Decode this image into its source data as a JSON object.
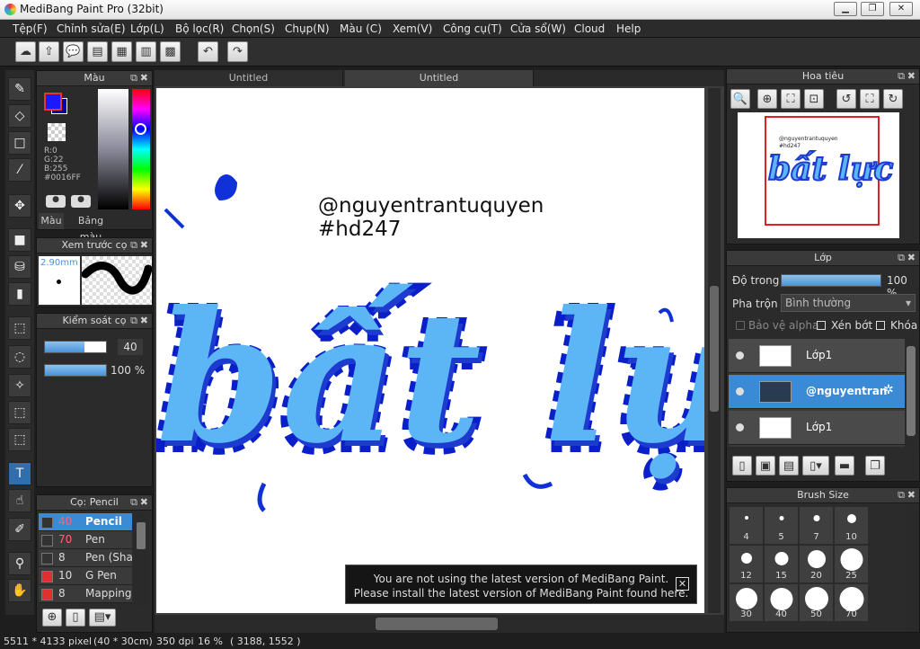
{
  "window": {
    "title": "MediBang Paint Pro (32bit)"
  },
  "menu": [
    "Tệp(F)",
    "Chỉnh sửa(E)",
    "Lớp(L)",
    "Bộ lọc(R)",
    "Chọn(S)",
    "Chụp(N)",
    "Màu (C)",
    "Xem(V)",
    "Công cụ(T)",
    "Cửa sổ(W)",
    "Cloud",
    "Help"
  ],
  "tabs": [
    "Untitled",
    "Untitled"
  ],
  "color_panel": {
    "title": "Màu",
    "r": "R:0",
    "g": "G:22",
    "b": "B:255",
    "hex": "#0016FF",
    "tab1": "Màu",
    "tab2": "Bảng màu",
    "primary": "#1a1aff",
    "secondary": "#0000aa"
  },
  "brush_preview": {
    "title": "Xem trước cọ",
    "size": "2.90mm"
  },
  "brush_control": {
    "title": "Kiểm soát cọ",
    "size_value": "40",
    "opacity_value": "100 %"
  },
  "brush_list": {
    "title": "Cọ: Pencil",
    "items": [
      {
        "num": "40",
        "name": "Pencil",
        "color": "#333333",
        "active": true
      },
      {
        "num": "70",
        "name": "Pen",
        "color": "#333333",
        "active": false
      },
      {
        "num": "8",
        "name": "Pen (Sha",
        "color": "#333333",
        "active": false
      },
      {
        "num": "10",
        "name": "G Pen",
        "color": "#e03030",
        "active": false
      },
      {
        "num": "8",
        "name": "Mapping",
        "color": "#e03030",
        "active": false
      }
    ]
  },
  "navigator": {
    "title": "Hoa tiêu",
    "thumb_handle": "@nguyentrantuquyen",
    "thumb_tag": "#hd247"
  },
  "layers": {
    "title": "Lớp",
    "opacity_label": "Độ trong",
    "opacity_value": "100 %",
    "opacity": 1.0,
    "blend_label": "Pha trộn",
    "blend_value": "Bình thường",
    "alpha_label": "Bảo vệ alpha",
    "clip_label": "Xén bớt",
    "lock_label": "Khóa",
    "items": [
      {
        "name": "Lớp1",
        "selected": false
      },
      {
        "name": "@nguyentran",
        "selected": true
      },
      {
        "name": "Lớp1",
        "selected": false
      }
    ]
  },
  "brush_size": {
    "title": "Brush Size",
    "sizes": [
      "4",
      "5",
      "7",
      "10",
      "12",
      "15",
      "20",
      "25",
      "30",
      "40",
      "50",
      "70"
    ]
  },
  "canvas": {
    "handle": "@nguyentrantuquyen",
    "tag": "#hd247",
    "art_text": "bất lực"
  },
  "notice": {
    "line1": "You are not using the latest version of MediBang Paint.",
    "line2": "Please install the latest version of MediBang Paint found here.",
    "close": "✕"
  },
  "status": {
    "size": "5511 * 4133 pixel",
    "cm": "(40 * 30cm)",
    "dpi": "350 dpi",
    "zoom": "16 %",
    "coords": "( 3188, 1552 )"
  }
}
